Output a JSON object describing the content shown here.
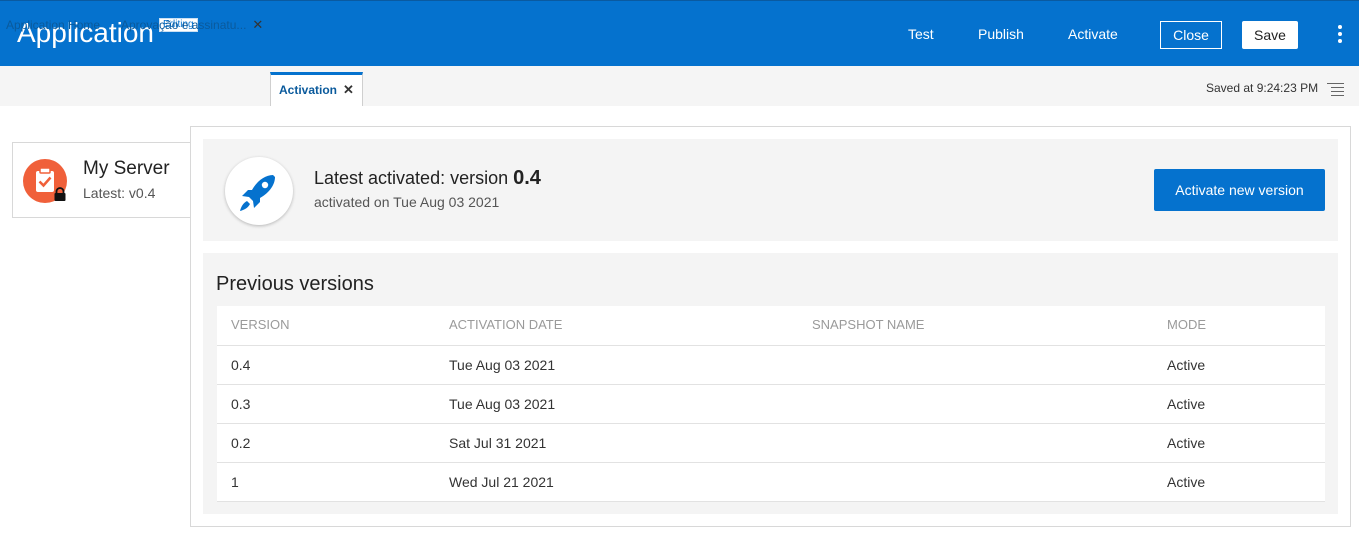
{
  "header": {
    "app_title": "Application",
    "editing_badge": "Editing",
    "links": {
      "test": "Test",
      "publish": "Publish",
      "activate": "Activate"
    },
    "close_label": "Close",
    "save_label": "Save",
    "more_icon": "kebab-menu-icon"
  },
  "tabs": [
    {
      "label": "Application Home",
      "closable": false
    },
    {
      "label": "Aprovação e assinatu...",
      "closable": true
    },
    {
      "label": "Activation",
      "closable": true,
      "active": true
    }
  ],
  "tab_close_glyph": "✕",
  "saved_at": "Saved at 9:24:23 PM",
  "server": {
    "name": "My Server",
    "latest": "Latest: v0.4",
    "icon": "clipboard-check-icon",
    "lock_icon": "lock-icon",
    "icon_color": "#f0603a"
  },
  "latest": {
    "prefix": "Latest activated: version ",
    "version": "0.4",
    "subtitle": "activated on Tue Aug 03 2021",
    "button": "Activate new version",
    "icon": "rocket-icon"
  },
  "previous": {
    "title": "Previous versions",
    "columns": [
      "VERSION",
      "ACTIVATION DATE",
      "SNAPSHOT NAME",
      "MODE"
    ],
    "rows": [
      {
        "version": "0.4",
        "date": "Tue Aug 03 2021",
        "snapshot": "",
        "mode": "Active"
      },
      {
        "version": "0.3",
        "date": "Tue Aug 03 2021",
        "snapshot": "",
        "mode": "Active"
      },
      {
        "version": "0.2",
        "date": "Sat Jul 31 2021",
        "snapshot": "",
        "mode": "Active"
      },
      {
        "version": "1",
        "date": "Wed Jul 21 2021",
        "snapshot": "",
        "mode": "Active"
      }
    ]
  },
  "colors": {
    "brand": "#0572ce",
    "accent_orange": "#f0603a"
  }
}
